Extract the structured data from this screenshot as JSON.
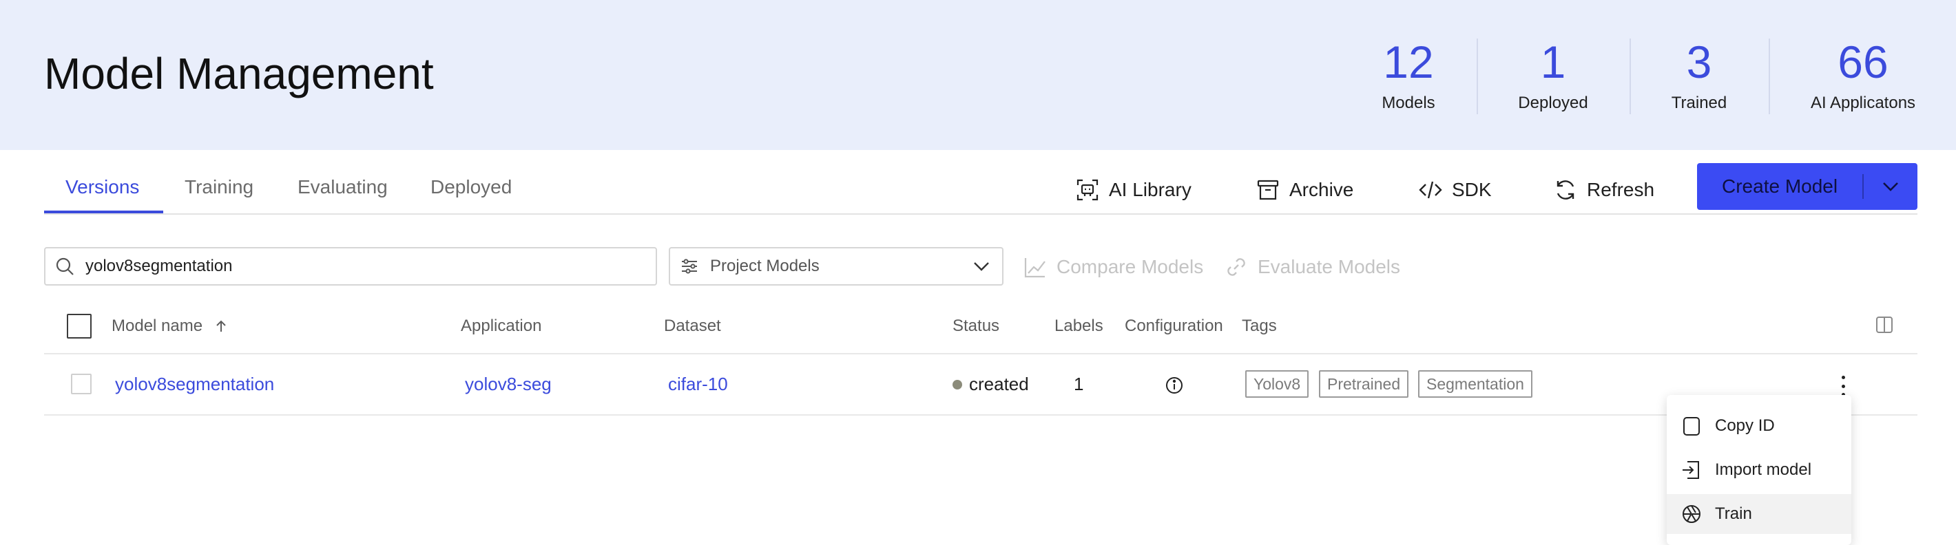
{
  "header": {
    "title": "Model Management",
    "stats": [
      {
        "value": "12",
        "label": "Models"
      },
      {
        "value": "1",
        "label": "Deployed"
      },
      {
        "value": "3",
        "label": "Trained"
      },
      {
        "value": "66",
        "label": "AI Applicatons"
      }
    ]
  },
  "tabs": [
    "Versions",
    "Training",
    "Evaluating",
    "Deployed"
  ],
  "active_tab": "Versions",
  "toolbar": {
    "ai_library": "AI Library",
    "archive": "Archive",
    "sdk": "SDK",
    "refresh": "Refresh",
    "create_model": "Create Model"
  },
  "filters": {
    "search_value": "yolov8segmentation",
    "project_select": "Project Models",
    "compare": "Compare Models",
    "evaluate": "Evaluate Models"
  },
  "table": {
    "columns": [
      "Model name",
      "Application",
      "Dataset",
      "Status",
      "Labels",
      "Configuration",
      "Tags"
    ],
    "rows": [
      {
        "model_name": "yolov8segmentation",
        "application": "yolov8-seg",
        "dataset": "cifar-10",
        "status": "created",
        "labels": "1",
        "tags": [
          "Yolov8",
          "Pretrained",
          "Segmentation"
        ]
      }
    ]
  },
  "row_menu": {
    "items": [
      "Copy ID",
      "Import model",
      "Train"
    ],
    "highlighted": "Train"
  },
  "colors": {
    "accent": "#3b4bdc",
    "primary_button": "#3b4bf3",
    "header_bg": "#e9eefb",
    "status_created": "#8b8b7a"
  }
}
